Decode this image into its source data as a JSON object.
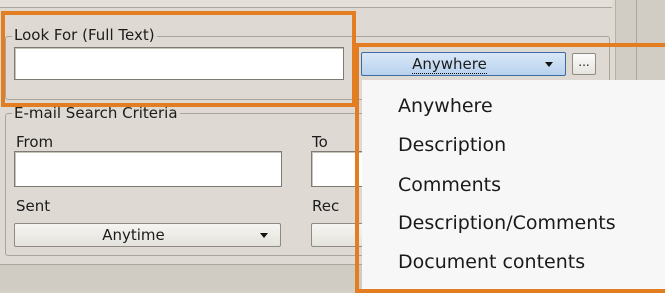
{
  "full_text": {
    "legend": "Look For (Full Text)",
    "query_value": "",
    "scope_selected": "Anywhere",
    "more_button_label": "..."
  },
  "email_criteria": {
    "legend": "E-mail Search Criteria",
    "from_label": "From",
    "from_value": "",
    "to_label": "To",
    "to_value": "",
    "sent_label": "Sent",
    "sent_selected": "Anytime",
    "received_label": "Rec"
  },
  "scope_dropdown": {
    "options": [
      "Anywhere",
      "Description",
      "Comments",
      "Description/Comments",
      "Document contents"
    ]
  },
  "highlight_color": "#e37d21"
}
